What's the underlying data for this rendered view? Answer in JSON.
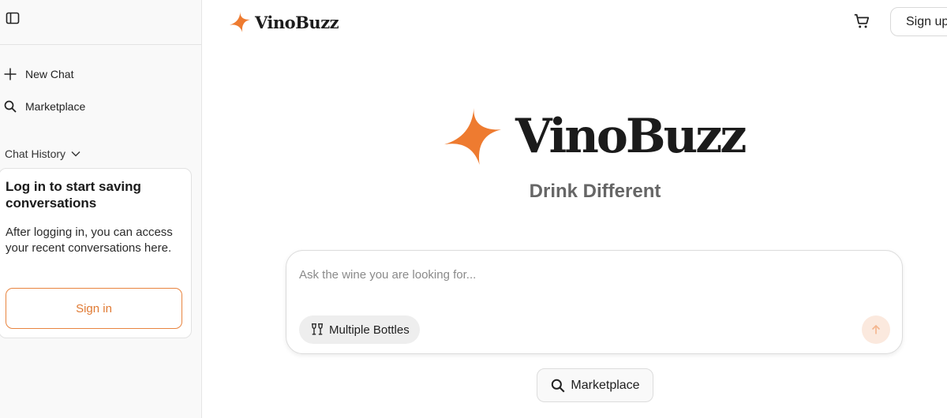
{
  "brand": {
    "name": "VinoBuzz",
    "tagline": "Drink Different",
    "accent": "#ee7b30"
  },
  "sidebar": {
    "toggle_icon": "sidebar-toggle-icon",
    "items": [
      {
        "label": "New Chat",
        "icon": "plus-icon"
      },
      {
        "label": "Marketplace",
        "icon": "search-icon"
      }
    ],
    "history_label": "Chat History",
    "login_card": {
      "title": "Log in to start saving conversations",
      "description": "After logging in, you can access your recent conversations here.",
      "button_label": "Sign in"
    }
  },
  "header": {
    "signup_label": "Sign up",
    "cart_icon": "cart-icon"
  },
  "chat": {
    "placeholder": "Ask the wine you are looking for...",
    "value": "",
    "multiple_bottles_label": "Multiple Bottles",
    "send_icon": "arrow-up-icon"
  },
  "marketplace_button": {
    "label": "Marketplace",
    "icon": "search-icon"
  }
}
